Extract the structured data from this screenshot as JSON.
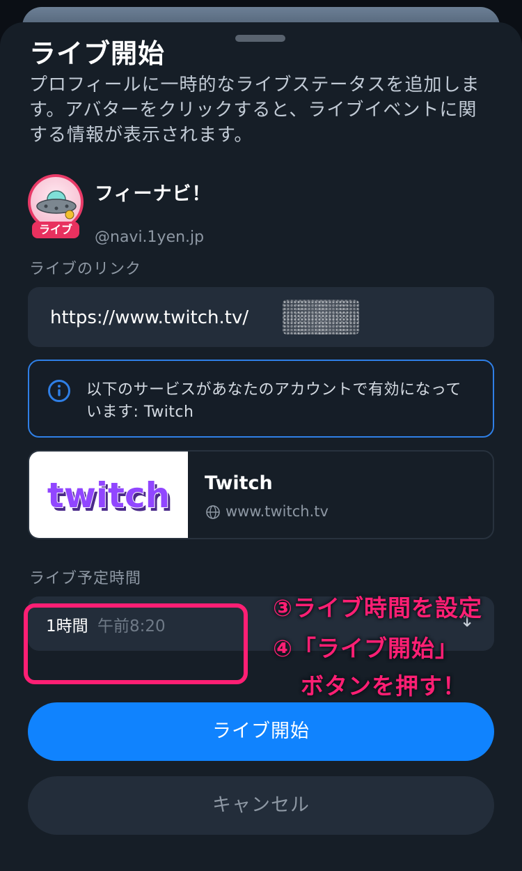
{
  "sheet": {
    "title": "ライブ開始",
    "description": "プロフィールに一時的なライブステータスを追加します。アバターをクリックすると、ライブイベントに関する情報が表示されます。"
  },
  "profile": {
    "display_name": "フィーナビ！",
    "handle": "@navi.1yen.jp",
    "live_badge": "ライブ",
    "avatar_icon": "ufo-avatar"
  },
  "live_link": {
    "label": "ライブのリンク",
    "value": "https://www.twitch.tv/"
  },
  "info": {
    "icon": "info-icon",
    "message": "以下のサービスがあなたのアカウントで有効になっています: Twitch"
  },
  "service": {
    "logo_text": "twitch",
    "name": "Twitch",
    "url": "www.twitch.tv",
    "url_icon": "globe-icon"
  },
  "schedule": {
    "label": "ライブ予定時間",
    "duration": "1時間",
    "end_time": "午前8:20",
    "chevron_icon": "up-down-chevron-icon"
  },
  "annotations": {
    "step3": "③ライブ時間を設定",
    "step4_line1": "④「ライブ開始」",
    "step4_line2": "ボタンを押す！"
  },
  "buttons": {
    "start": "ライブ開始",
    "cancel": "キャンセル"
  },
  "colors": {
    "accent_blue": "#1083fe",
    "annotation_pink": "#ff1f74",
    "twitch_purple": "#9146ff"
  }
}
